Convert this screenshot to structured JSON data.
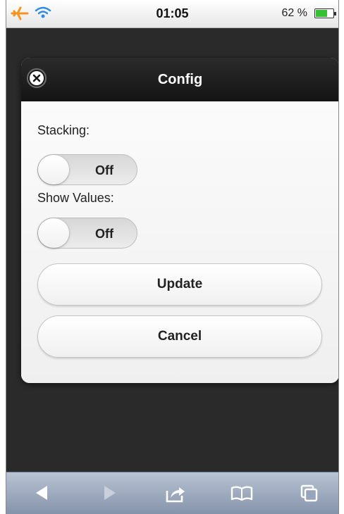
{
  "status_bar": {
    "time": "01:05",
    "battery_percent": "62 %",
    "battery_level": 0.62
  },
  "dialog": {
    "title": "Config",
    "fields": [
      {
        "label": "Stacking:",
        "state": "Off"
      },
      {
        "label": "Show Values:",
        "state": "Off"
      }
    ],
    "buttons": {
      "update": "Update",
      "cancel": "Cancel"
    }
  },
  "toolbar": {
    "icons": [
      "back-icon",
      "forward-icon",
      "share-icon",
      "bookmarks-icon",
      "tabs-icon"
    ]
  },
  "colors": {
    "header": "#1a1a1a",
    "airplane": "#f7941d",
    "wifi": "#2e8ae6",
    "battery": "#36c135",
    "toolbar": "#9aa6bb"
  }
}
